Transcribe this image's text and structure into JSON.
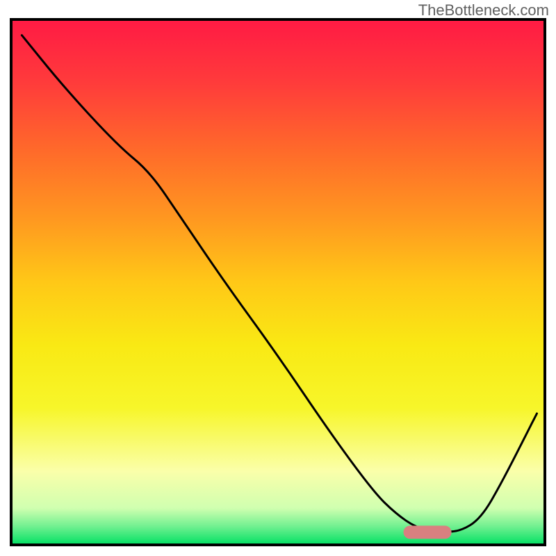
{
  "watermark": "TheBottleneck.com",
  "chart_data": {
    "type": "line",
    "title": "",
    "xlabel": "",
    "ylabel": "",
    "xlim": [
      0,
      100
    ],
    "ylim": [
      0,
      100
    ],
    "grid": false,
    "series": [
      {
        "name": "curve",
        "color": "#000000",
        "stroke_width": 3,
        "x": [
          2,
          10,
          20,
          26,
          32,
          40,
          50,
          60,
          68,
          72,
          76,
          80,
          84,
          88,
          92,
          98.5
        ],
        "y": [
          97,
          87,
          76,
          71,
          62,
          50,
          36,
          21,
          10,
          6,
          3.2,
          2.5,
          2.5,
          5,
          12,
          25
        ]
      }
    ],
    "marker": {
      "shape": "rounded-rect",
      "x_center": 78,
      "y_center": 2.4,
      "width": 9,
      "height": 2.5,
      "color": "#d98080"
    },
    "background_gradient": {
      "type": "vertical",
      "stops": [
        {
          "pos": 0.0,
          "color": "#ff1a44"
        },
        {
          "pos": 0.12,
          "color": "#ff3b3b"
        },
        {
          "pos": 0.25,
          "color": "#ff6a2a"
        },
        {
          "pos": 0.38,
          "color": "#ff9820"
        },
        {
          "pos": 0.5,
          "color": "#ffc817"
        },
        {
          "pos": 0.62,
          "color": "#f9e914"
        },
        {
          "pos": 0.74,
          "color": "#f7f62a"
        },
        {
          "pos": 0.86,
          "color": "#faffaa"
        },
        {
          "pos": 0.93,
          "color": "#d0ffb0"
        },
        {
          "pos": 0.965,
          "color": "#70f090"
        },
        {
          "pos": 1.0,
          "color": "#00e063"
        }
      ]
    },
    "frame": {
      "color": "#000000",
      "width": 4
    }
  }
}
